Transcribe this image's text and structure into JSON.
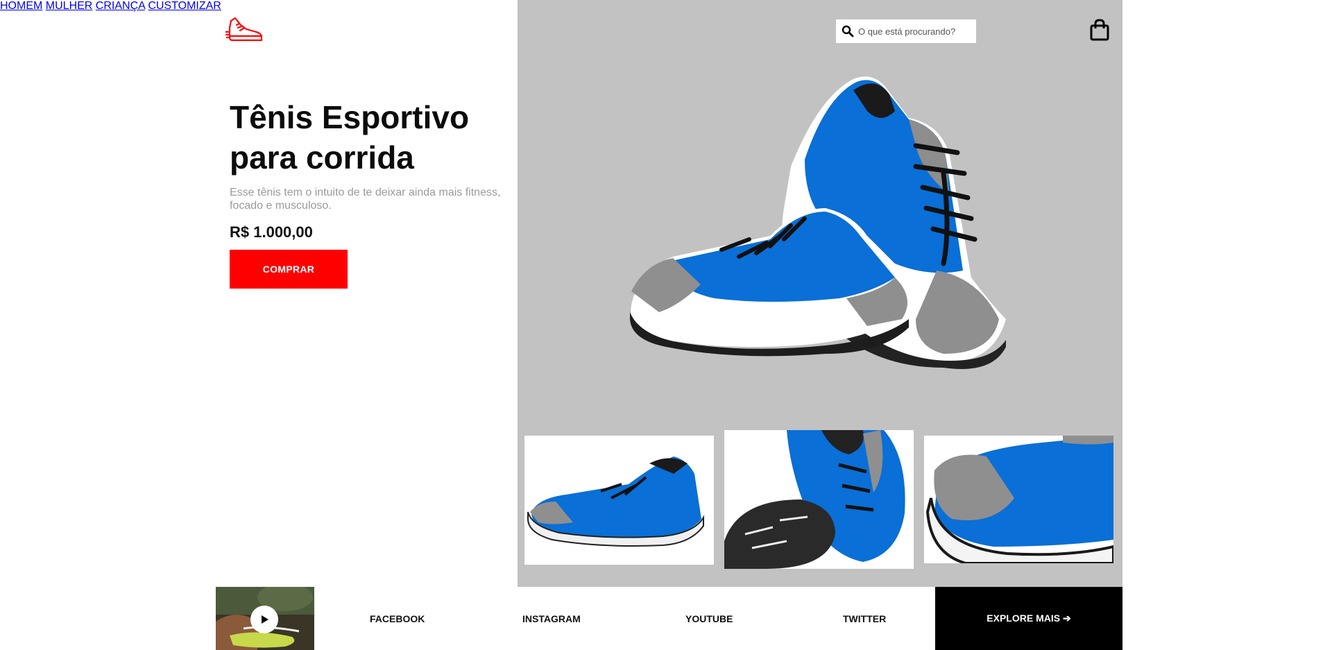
{
  "brand": {
    "logo_icon": "running-shoe-icon",
    "accent_color": "#ff0000"
  },
  "nav": {
    "items": [
      {
        "label": "HOMEM"
      },
      {
        "label": "MULHER"
      },
      {
        "label": "CRIANÇA"
      },
      {
        "label": "CUSTOMIZAR"
      }
    ]
  },
  "search": {
    "placeholder": "O que está procurando?",
    "value": "",
    "icon": "search-icon"
  },
  "cart": {
    "icon": "shopping-bag-icon"
  },
  "hero": {
    "title": "Tênis Esportivo para corrida",
    "subtitle": "Esse tênis tem o intuito de te deixar ainda mais fitness, focado e musculoso.",
    "price": "R$ 1.000,00",
    "buy_label": "COMPRAR",
    "panel_color": "#c2c2c2",
    "shoe_color": "#0a6fd6"
  },
  "thumbnails": [
    {
      "name": "shoe-pair-side-view"
    },
    {
      "name": "shoe-sole-view"
    },
    {
      "name": "shoe-toe-closeup"
    }
  ],
  "footer": {
    "video": {
      "play_icon": "play-icon"
    },
    "social": [
      {
        "label": "FACEBOOK"
      },
      {
        "label": "INSTAGRAM"
      },
      {
        "label": "YOUTUBE"
      },
      {
        "label": "TWITTER"
      }
    ],
    "explore_label": "EXPLORE MAIS ➔"
  }
}
